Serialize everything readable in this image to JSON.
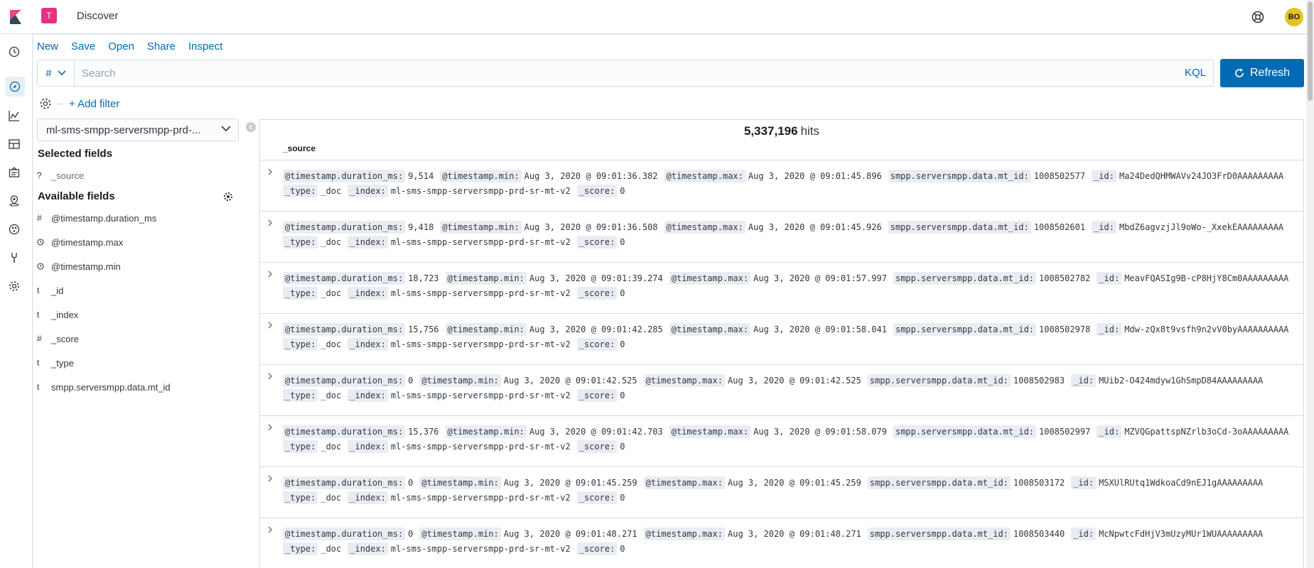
{
  "header": {
    "space_initial": "T",
    "app_title": "Discover",
    "avatar_initials": "BO"
  },
  "nav": [
    "recently-viewed-icon",
    "discover-icon",
    "visualize-icon",
    "dashboard-icon",
    "canvas-icon",
    "maps-icon",
    "ml-icon",
    "dev-tools-icon",
    "management-icon"
  ],
  "menu": {
    "new": "New",
    "save": "Save",
    "open": "Open",
    "share": "Share",
    "inspect": "Inspect"
  },
  "query": {
    "lang_symbol": "#",
    "placeholder": "Search",
    "value": "",
    "kql": "KQL",
    "refresh": "Refresh"
  },
  "filters": {
    "add_filter": "+ Add filter"
  },
  "sidebar": {
    "index_pattern": "ml-sms-smpp-serversmpp-prd-...",
    "selected_title": "Selected fields",
    "selected_fields": [
      {
        "type": "?",
        "name": "_source"
      }
    ],
    "available_title": "Available fields",
    "available_fields": [
      {
        "type": "#",
        "name": "@timestamp.duration_ms"
      },
      {
        "type": "clock",
        "name": "@timestamp.max"
      },
      {
        "type": "clock",
        "name": "@timestamp.min"
      },
      {
        "type": "t",
        "name": "_id"
      },
      {
        "type": "t",
        "name": "_index"
      },
      {
        "type": "#",
        "name": "_score"
      },
      {
        "type": "t",
        "name": "_type"
      },
      {
        "type": "t",
        "name": "smpp.serversmpp.data.mt_id"
      }
    ]
  },
  "results": {
    "hits_count": "5,337,196",
    "hits_label": "hits",
    "column": "_source",
    "docs": [
      {
        "line1": [
          [
            "@timestamp.duration_ms:",
            "9,514"
          ],
          [
            "@timestamp.min:",
            "Aug 3, 2020 @ 09:01:36.382"
          ],
          [
            "@timestamp.max:",
            "Aug 3, 2020 @ 09:01:45.896"
          ],
          [
            "smpp.serversmpp.data.mt_id:",
            "1008502577"
          ],
          [
            "_id:",
            "Ma24DedQHMWAVv24JO3FrD0AAAAAAAAA"
          ]
        ],
        "line2": [
          [
            "_type:",
            "_doc"
          ],
          [
            "_index:",
            "ml-sms-smpp-serversmpp-prd-sr-mt-v2"
          ],
          [
            "_score:",
            "0"
          ]
        ]
      },
      {
        "line1": [
          [
            "@timestamp.duration_ms:",
            "9,418"
          ],
          [
            "@timestamp.min:",
            "Aug 3, 2020 @ 09:01:36.508"
          ],
          [
            "@timestamp.max:",
            "Aug 3, 2020 @ 09:01:45.926"
          ],
          [
            "smpp.serversmpp.data.mt_id:",
            "1008502601"
          ],
          [
            "_id:",
            "MbdZ6agvzjJl9oWo-_XxekEAAAAAAAAA"
          ]
        ],
        "line2": [
          [
            "_type:",
            "_doc"
          ],
          [
            "_index:",
            "ml-sms-smpp-serversmpp-prd-sr-mt-v2"
          ],
          [
            "_score:",
            "0"
          ]
        ]
      },
      {
        "line1": [
          [
            "@timestamp.duration_ms:",
            "18,723"
          ],
          [
            "@timestamp.min:",
            "Aug 3, 2020 @ 09:01:39.274"
          ],
          [
            "@timestamp.max:",
            "Aug 3, 2020 @ 09:01:57.997"
          ],
          [
            "smpp.serversmpp.data.mt_id:",
            "1008502782"
          ],
          [
            "_id:",
            "MeavFQASIg9B-cP8HjY8Cm0AAAAAAAAA"
          ]
        ],
        "line2": [
          [
            "_type:",
            "_doc"
          ],
          [
            "_index:",
            "ml-sms-smpp-serversmpp-prd-sr-mt-v2"
          ],
          [
            "_score:",
            "0"
          ]
        ]
      },
      {
        "line1": [
          [
            "@timestamp.duration_ms:",
            "15,756"
          ],
          [
            "@timestamp.min:",
            "Aug 3, 2020 @ 09:01:42.285"
          ],
          [
            "@timestamp.max:",
            "Aug 3, 2020 @ 09:01:58.041"
          ],
          [
            "smpp.serversmpp.data.mt_id:",
            "1008502978"
          ],
          [
            "_id:",
            "Mdw-zQx8t9vsfh9n2vV0byAAAAAAAAAA"
          ]
        ],
        "line2": [
          [
            "_type:",
            "_doc"
          ],
          [
            "_index:",
            "ml-sms-smpp-serversmpp-prd-sr-mt-v2"
          ],
          [
            "_score:",
            "0"
          ]
        ]
      },
      {
        "line1": [
          [
            "@timestamp.duration_ms:",
            "0"
          ],
          [
            "@timestamp.min:",
            "Aug 3, 2020 @ 09:01:42.525"
          ],
          [
            "@timestamp.max:",
            "Aug 3, 2020 @ 09:01:42.525"
          ],
          [
            "smpp.serversmpp.data.mt_id:",
            "1008502983"
          ],
          [
            "_id:",
            "MUib2-O424mdyw1GhSmpD84AAAAAAAAA"
          ]
        ],
        "line2": [
          [
            "_type:",
            "_doc"
          ],
          [
            "_index:",
            "ml-sms-smpp-serversmpp-prd-sr-mt-v2"
          ],
          [
            "_score:",
            "0"
          ]
        ]
      },
      {
        "line1": [
          [
            "@timestamp.duration_ms:",
            "15,376"
          ],
          [
            "@timestamp.min:",
            "Aug 3, 2020 @ 09:01:42.703"
          ],
          [
            "@timestamp.max:",
            "Aug 3, 2020 @ 09:01:58.079"
          ],
          [
            "smpp.serversmpp.data.mt_id:",
            "1008502997"
          ],
          [
            "_id:",
            "MZVQGpattspNZrlb3oCd-3oAAAAAAAAA"
          ]
        ],
        "line2": [
          [
            "_type:",
            "_doc"
          ],
          [
            "_index:",
            "ml-sms-smpp-serversmpp-prd-sr-mt-v2"
          ],
          [
            "_score:",
            "0"
          ]
        ]
      },
      {
        "line1": [
          [
            "@timestamp.duration_ms:",
            "0"
          ],
          [
            "@timestamp.min:",
            "Aug 3, 2020 @ 09:01:45.259"
          ],
          [
            "@timestamp.max:",
            "Aug 3, 2020 @ 09:01:45.259"
          ],
          [
            "smpp.serversmpp.data.mt_id:",
            "1008503172"
          ],
          [
            "_id:",
            "MSXUlRUtq1WdkoaCd9nEJ1gAAAAAAAAA"
          ]
        ],
        "line2": [
          [
            "_type:",
            "_doc"
          ],
          [
            "_index:",
            "ml-sms-smpp-serversmpp-prd-sr-mt-v2"
          ],
          [
            "_score:",
            "0"
          ]
        ]
      },
      {
        "line1": [
          [
            "@timestamp.duration_ms:",
            "0"
          ],
          [
            "@timestamp.min:",
            "Aug 3, 2020 @ 09:01:48.271"
          ],
          [
            "@timestamp.max:",
            "Aug 3, 2020 @ 09:01:48.271"
          ],
          [
            "smpp.serversmpp.data.mt_id:",
            "1008503440"
          ],
          [
            "_id:",
            "McNpwtcFdHjV3mUzyMUr1WUAAAAAAAAA"
          ]
        ],
        "line2": [
          [
            "_type:",
            "_doc"
          ],
          [
            "_index:",
            "ml-sms-smpp-serversmpp-prd-sr-mt-v2"
          ],
          [
            "_score:",
            "0"
          ]
        ]
      }
    ]
  },
  "colors": {
    "accent": "#006bb4",
    "space_badge": "#e7317f",
    "avatar": "#e6c220",
    "border": "#d3dae6"
  }
}
